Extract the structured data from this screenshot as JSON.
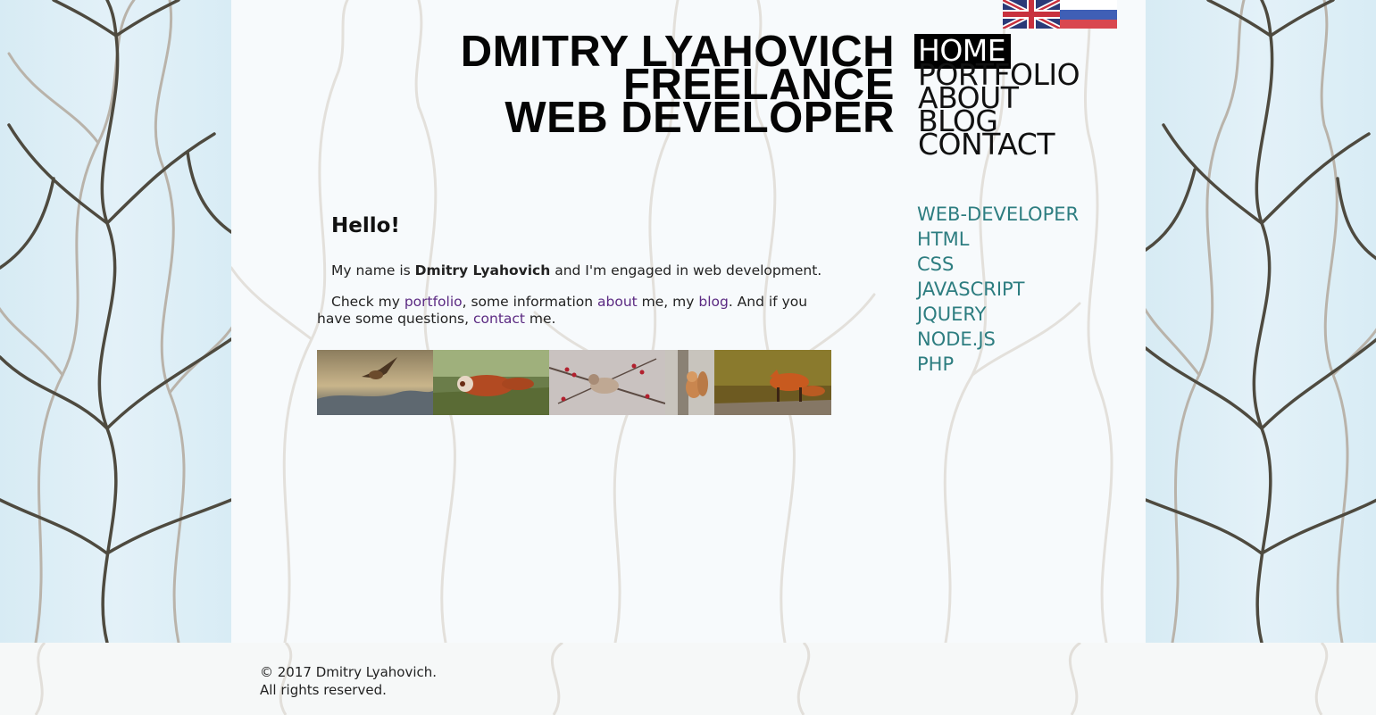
{
  "header": {
    "title_lines": [
      "DMITRY LYAHOVICH",
      "FREELANCE",
      "WEB DEVELOPER"
    ]
  },
  "languages": [
    {
      "name": "uk-flag-icon"
    },
    {
      "name": "ru-flag-icon"
    }
  ],
  "main_nav": [
    {
      "label": "HOME",
      "active": true
    },
    {
      "label": "PORTFOLIO"
    },
    {
      "label": "ABOUT"
    },
    {
      "label": "BLOG"
    },
    {
      "label": "CONTACT"
    }
  ],
  "sub_nav": [
    "WEB-DEVELOPER",
    "HTML",
    "CSS",
    "JAVASCRIPT",
    "JQUERY",
    "NODE.JS",
    "PHP"
  ],
  "content": {
    "heading": "Hello!",
    "p1_before": "My name is ",
    "p1_name": "Dmitry Lyahovich",
    "p1_after": " and I'm engaged in web development.",
    "p2_a": "Check my ",
    "link_portfolio": "portfolio",
    "p2_b": ", some information ",
    "link_about": "about",
    "p2_c": " me, my ",
    "link_blog": "blog",
    "p2_d": ". And if you have some questions, ",
    "link_contact": "contact",
    "p2_e": " me."
  },
  "gallery": [
    "owl-photo",
    "red-panda-photo",
    "waxwing-bird-photo",
    "squirrel-photo",
    "fox-photo"
  ],
  "colors": {
    "link_purple": "#5b2a82",
    "subnav_teal": "#2d7d80",
    "side_blue": "#dcedf5"
  },
  "footer": {
    "copyright": "© 2017 Dmitry Lyahovich.",
    "rights": "All rights reserved."
  }
}
